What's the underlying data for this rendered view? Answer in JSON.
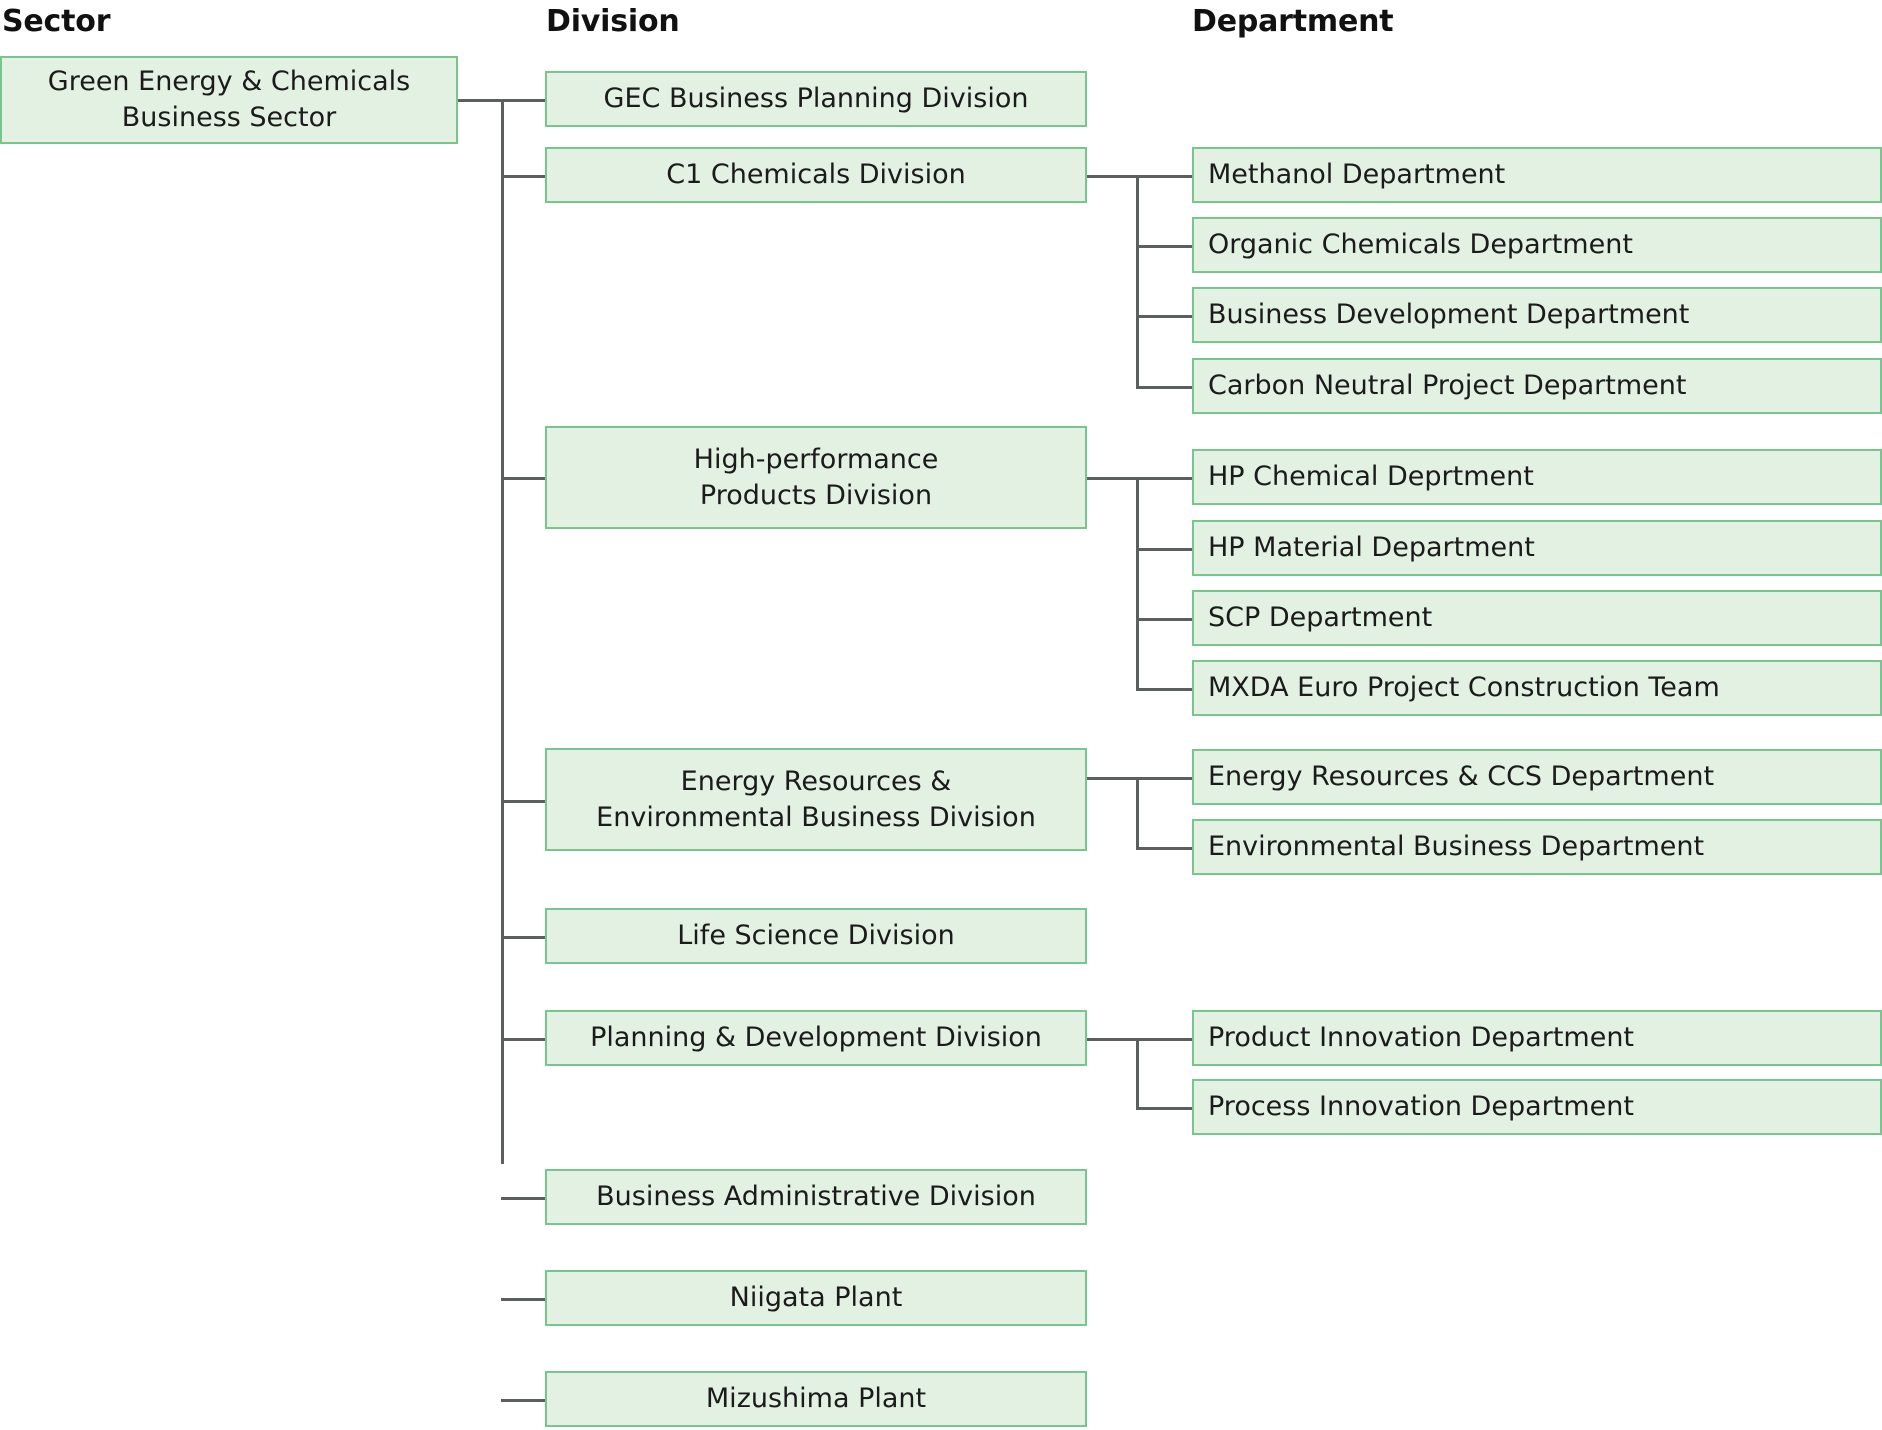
{
  "columns": {
    "sector_header": "Sector",
    "division_header": "Division",
    "department_header": "Department"
  },
  "colors": {
    "box_fill": "#e3f1e3",
    "box_border": "#77c68d",
    "connector": "#5b5f5e",
    "text": "#1b1b1b",
    "background": "#ffffff"
  },
  "sector": {
    "label": "Green Energy & Chemicals\nBusiness Sector",
    "line1": "Green Energy & Chemicals",
    "line2": "Business Sector"
  },
  "divisions": [
    {
      "label": "GEC Business Planning Division",
      "line1": "GEC Business Planning Division",
      "line2": "",
      "departments": []
    },
    {
      "label": "C1 Chemicals Division",
      "line1": "C1 Chemicals Division",
      "line2": "",
      "departments": [
        "Methanol Department",
        "Organic Chemicals Department",
        "Business Development Department",
        "Carbon Neutral Project Department"
      ]
    },
    {
      "label": "High-performance Products Division",
      "line1": "High-performance",
      "line2": "Products Division",
      "departments": [
        "HP Chemical Deprtment",
        "HP Material Department",
        "SCP Department",
        "MXDA Euro Project Construction Team"
      ]
    },
    {
      "label": "Energy Resources & Environmental Business Division",
      "line1": "Energy Resources &",
      "line2": "Environmental Business Division",
      "departments": [
        "Energy Resources & CCS Department",
        "Environmental Business Department"
      ]
    },
    {
      "label": "Life Science Division",
      "line1": "Life Science Division",
      "line2": "",
      "departments": []
    },
    {
      "label": "Planning & Development Division",
      "line1": "Planning & Development Division",
      "line2": "",
      "departments": [
        "Product Innovation Department",
        "Process Innovation Department"
      ]
    },
    {
      "label": "Business Administrative Division",
      "line1": "Business Administrative Division",
      "line2": "",
      "departments": []
    },
    {
      "label": "Niigata Plant",
      "line1": "Niigata Plant",
      "line2": "",
      "departments": []
    },
    {
      "label": "Mizushima Plant",
      "line1": "Mizushima Plant",
      "line2": "",
      "departments": []
    }
  ],
  "departments_flat": [
    "Methanol Department",
    "Organic Chemicals Department",
    "Business Development Department",
    "Carbon Neutral Project Department",
    "HP Chemical Deprtment",
    "HP Material Department",
    "SCP Department",
    "MXDA Euro Project Construction Team",
    "Energy Resources & CCS Department",
    "Environmental Business Department",
    "Product Innovation Department",
    "Process Innovation Department"
  ]
}
